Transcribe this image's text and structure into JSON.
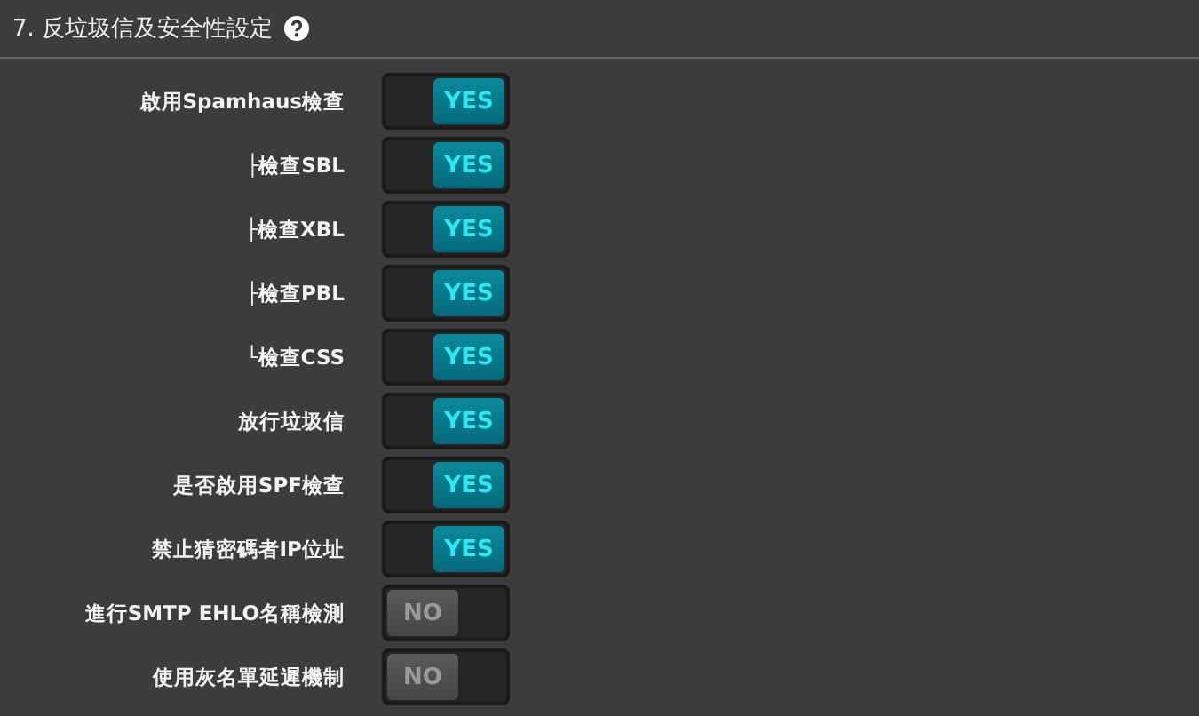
{
  "section": {
    "title": "7. 反垃圾信及安全性設定",
    "help_icon": true
  },
  "settings": [
    {
      "label": "啟用Spamhaus檢查",
      "on": true,
      "value": "YES"
    },
    {
      "label": "├檢查SBL",
      "on": true,
      "value": "YES"
    },
    {
      "label": "├檢查XBL",
      "on": true,
      "value": "YES"
    },
    {
      "label": "├檢查PBL",
      "on": true,
      "value": "YES"
    },
    {
      "label": "└檢查CSS",
      "on": true,
      "value": "YES"
    },
    {
      "label": "放行垃圾信",
      "on": true,
      "value": "YES"
    },
    {
      "label": "是否啟用SPF檢查",
      "on": true,
      "value": "YES"
    },
    {
      "label": "禁止猜密碼者IP位址",
      "on": true,
      "value": "YES"
    },
    {
      "label": "進行SMTP EHLO名稱檢測",
      "on": false,
      "value": "NO"
    },
    {
      "label": "使用灰名單延遲機制",
      "on": false,
      "value": "NO"
    }
  ]
}
